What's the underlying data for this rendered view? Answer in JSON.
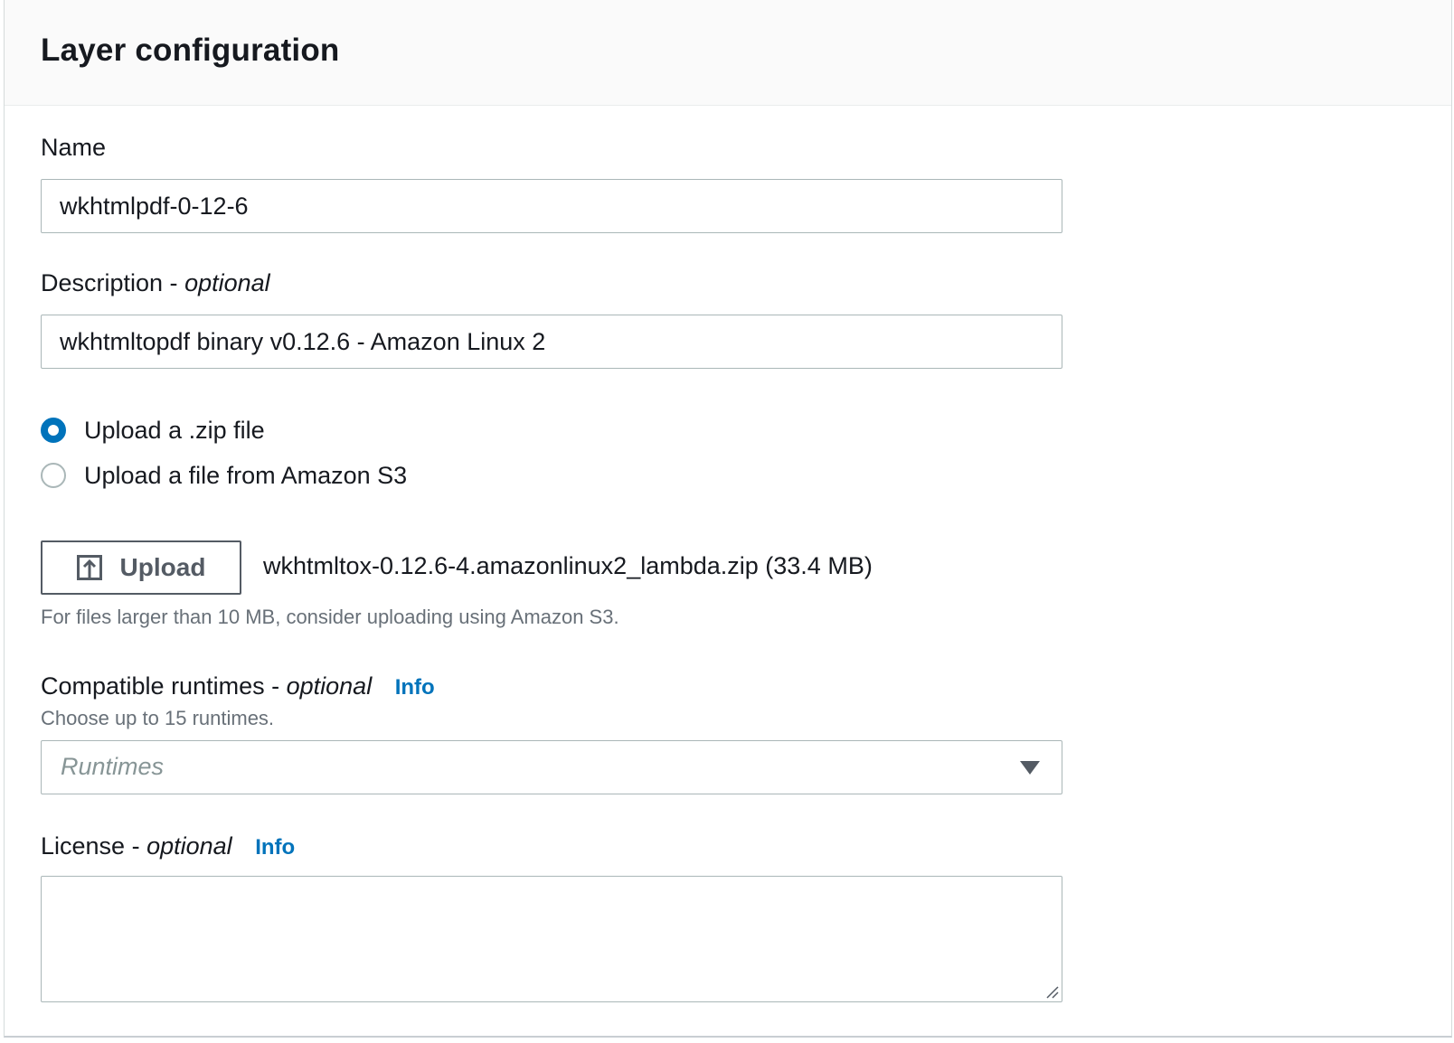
{
  "panel": {
    "title": "Layer configuration"
  },
  "name_field": {
    "label": "Name",
    "value": "wkhtmlpdf-0-12-6"
  },
  "description_field": {
    "label": "Description -",
    "optional": "optional",
    "value": "wkhtmltopdf binary v0.12.6 - Amazon Linux 2"
  },
  "upload_options": [
    {
      "label": "Upload a .zip file",
      "checked": true
    },
    {
      "label": "Upload a file from Amazon S3",
      "checked": false
    }
  ],
  "upload": {
    "button_label": "Upload",
    "icon": "upload-icon",
    "file_name": "wkhtmltox-0.12.6-4.amazonlinux2_lambda.zip (33.4 MB)",
    "hint": "For files larger than 10 MB, consider uploading using Amazon S3."
  },
  "runtimes": {
    "label": "Compatible runtimes -",
    "optional": "optional",
    "info": "Info",
    "hint": "Choose up to 15 runtimes.",
    "placeholder": "Runtimes",
    "icon": "caret-down-icon"
  },
  "license": {
    "label": "License -",
    "optional": "optional",
    "info": "Info",
    "value": ""
  },
  "colors": {
    "accent": "#0073bb",
    "text": "#16191f",
    "muted": "#687078",
    "border": "#aab7b8",
    "header_bg": "#fafafa"
  }
}
